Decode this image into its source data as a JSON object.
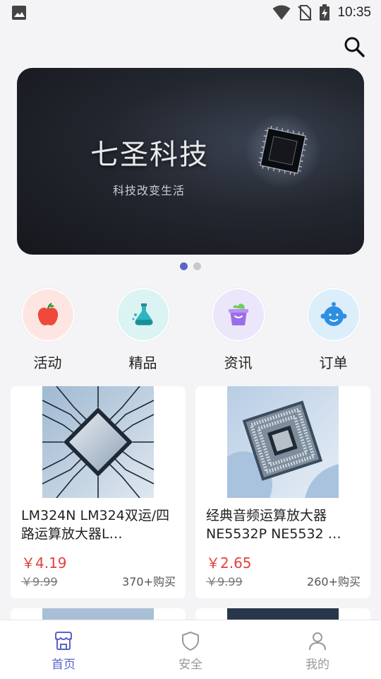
{
  "statusbar": {
    "time": "10:35"
  },
  "banner": {
    "title": "七圣科技",
    "subtitle": "科技改变生活",
    "page_count": 2,
    "active_page": 1
  },
  "categories": [
    {
      "label": "活动",
      "icon": "apple-icon",
      "bg": "#fde6e2"
    },
    {
      "label": "精品",
      "icon": "flask-icon",
      "bg": "#dcf3f3"
    },
    {
      "label": "资讯",
      "icon": "bag-icon",
      "bg": "#ece6fb"
    },
    {
      "label": "订单",
      "icon": "baby-icon",
      "bg": "#ddeefb"
    }
  ],
  "products": [
    {
      "name": "LM324N LM324双运/四路运算放大器L…",
      "price": "￥4.19",
      "original_price": "￥9.99",
      "sold": "370+购买"
    },
    {
      "name": "经典音频运算放大器 NE5532P NE5532 …",
      "price": "￥2.65",
      "original_price": "￥9.99",
      "sold": "260+购买"
    }
  ],
  "tabs": [
    {
      "label": "首页",
      "icon": "store-icon",
      "active": true
    },
    {
      "label": "安全",
      "icon": "shield-icon",
      "active": false
    },
    {
      "label": "我的",
      "icon": "user-icon",
      "active": false
    }
  ],
  "colors": {
    "accent": "#5b63c9",
    "price": "#e2413a"
  }
}
